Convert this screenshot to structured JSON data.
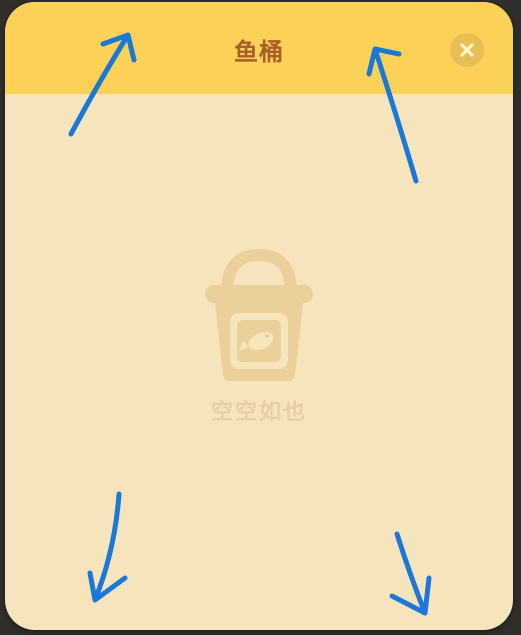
{
  "panel": {
    "title": "鱼桶",
    "close_icon": "close-icon"
  },
  "empty_state": {
    "icon": "fish-bucket-icon",
    "text": "空空如也"
  },
  "annotations": {
    "color": "#1b78d8",
    "arrows": [
      "arrow-up-left",
      "arrow-up-right",
      "arrow-down-left",
      "arrow-down-right"
    ]
  }
}
